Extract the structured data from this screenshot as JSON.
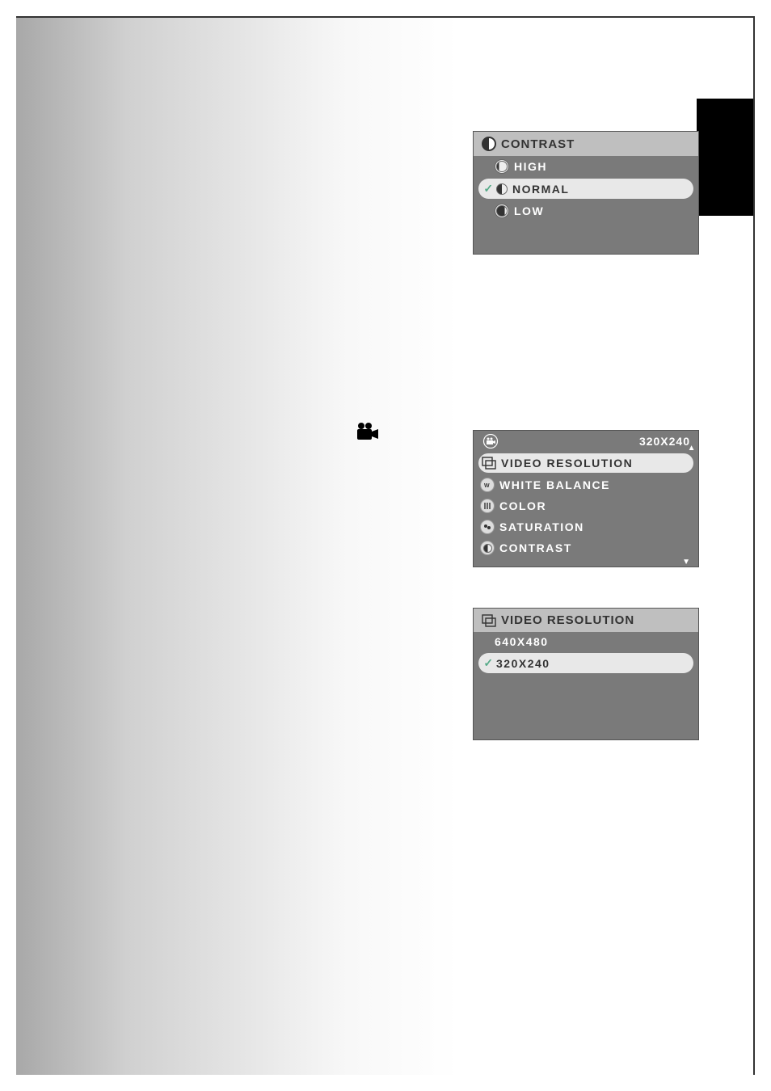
{
  "contrast_menu": {
    "title": "CONTRAST",
    "items": [
      {
        "label": "HIGH",
        "selected": false
      },
      {
        "label": "NORMAL",
        "selected": true
      },
      {
        "label": "LOW",
        "selected": false
      }
    ]
  },
  "video_menu": {
    "status_value": "320X240",
    "items": [
      {
        "label": "VIDEO RESOLUTION",
        "highlight": true
      },
      {
        "label": "WHITE BALANCE",
        "highlight": false
      },
      {
        "label": "COLOR",
        "highlight": false
      },
      {
        "label": "SATURATION",
        "highlight": false
      },
      {
        "label": "CONTRAST",
        "highlight": false
      }
    ]
  },
  "resolution_menu": {
    "title": "VIDEO RESOLUTION",
    "items": [
      {
        "label": "640X480",
        "selected": false
      },
      {
        "label": "320X240",
        "selected": true
      }
    ]
  }
}
